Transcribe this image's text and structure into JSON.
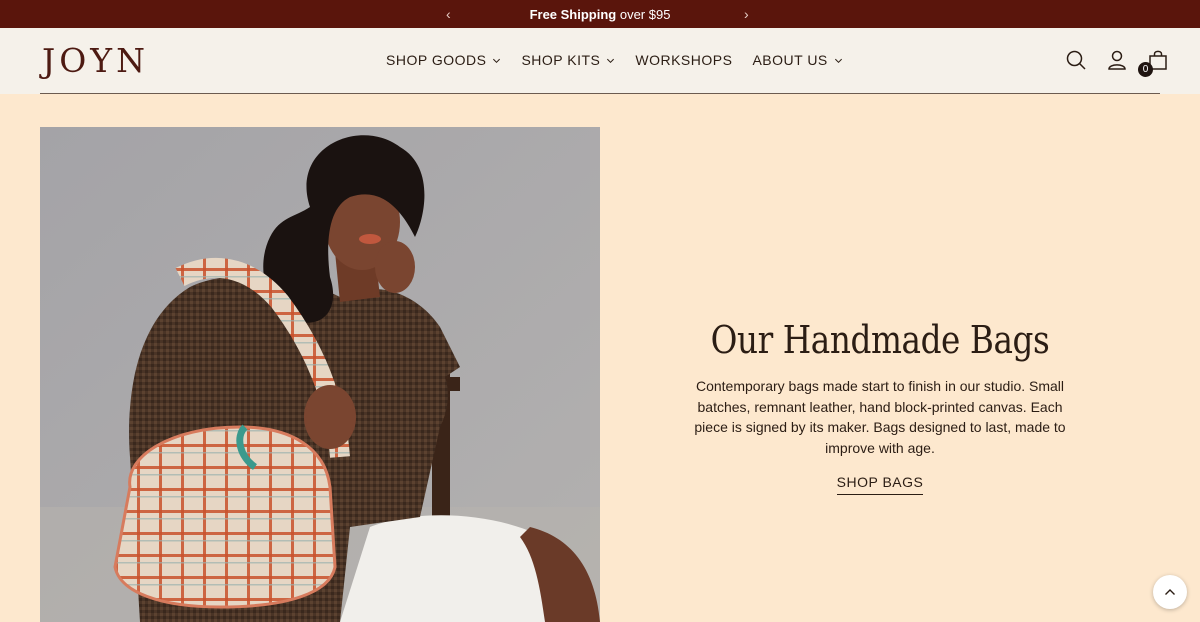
{
  "announcement": {
    "bold_text": "Free Shipping",
    "rest_text": " over $95",
    "prev_arrow": "‹",
    "next_arrow": "›"
  },
  "header": {
    "logo": "JOYN",
    "nav": [
      {
        "label": "SHOP GOODS",
        "has_dropdown": true
      },
      {
        "label": "SHOP KITS",
        "has_dropdown": true
      },
      {
        "label": "WORKSHOPS",
        "has_dropdown": false
      },
      {
        "label": "ABOUT US",
        "has_dropdown": true
      }
    ],
    "icons": [
      "search-icon",
      "account-icon",
      "bag-icon"
    ],
    "cart_count": "0"
  },
  "hero": {
    "image_icon": "model-with-plaid-bag-photo",
    "title": "Our Handmade Bags",
    "description": "Contemporary bags made start to finish in our studio. Small batches, remnant leather, hand block-printed canvas. Each piece is signed by its maker. Bags designed to last, made to improve with age.",
    "cta": "SHOP BAGS"
  },
  "colors": {
    "announcement_bg": "#5A150C",
    "header_bg": "#F5F1EA",
    "page_bg": "#FDE8CE",
    "logo": "#4D1A12"
  },
  "scroll_to_top_icon": "chevron-up-icon"
}
